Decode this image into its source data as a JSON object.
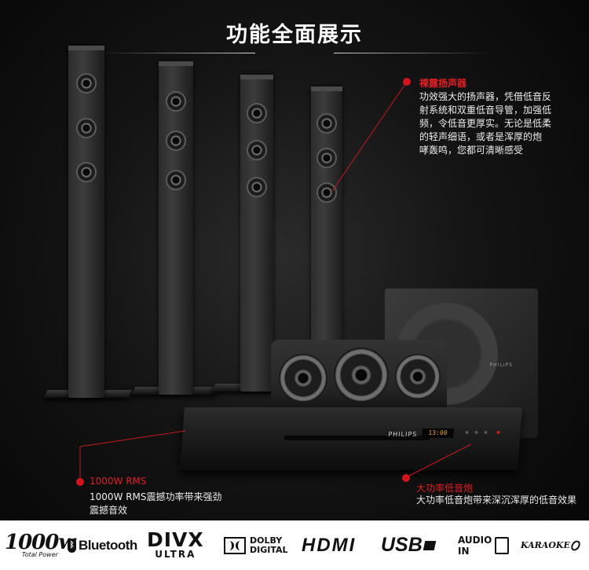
{
  "header": {
    "title": "功能全面展示"
  },
  "annotations": {
    "speakers": {
      "title": "裸露扬声器",
      "lines": [
        "功效强大的扬声器，凭借低音反",
        "射系统和双重低音导管，加强低",
        "频，令低音更厚实。无论是低柔",
        "的轻声细语，或者是浑厚的炮",
        "哮轰鸣，您都可清晰感受"
      ]
    },
    "power": {
      "title": "1000W RMS",
      "lines": [
        "1000W RMS震撼功率带来强劲",
        "震撼音效"
      ]
    },
    "subwoofer": {
      "title": "大功率低音炮",
      "lines": [
        "大功率低音炮带来深沉浑厚的低音效果"
      ]
    }
  },
  "product": {
    "subwoofer_brand": "PHILIPS",
    "player_brand": "PHILIPS",
    "display_text": "13:00"
  },
  "features": [
    {
      "icon": "power-1000w-logo",
      "label": "1000w",
      "sub": "Total Power"
    },
    {
      "icon": "bluetooth-logo",
      "label": "Bluetooth"
    },
    {
      "icon": "divx-ultra-logo",
      "label": "DIVX",
      "sub": "ULTRA"
    },
    {
      "icon": "dolby-digital-logo",
      "label": "DOLBY",
      "sub": "DIGITAL"
    },
    {
      "icon": "hdmi-logo",
      "label": "HDMI"
    },
    {
      "icon": "usb-logo",
      "label": "USB"
    },
    {
      "icon": "audio-in-logo",
      "label": "AUDIO",
      "sub": "IN"
    },
    {
      "icon": "karaoke-logo",
      "label": "KARAOKE"
    }
  ],
  "colors": {
    "accent": "#e21d26",
    "background": "#0b0b0b",
    "logo_bar": "#ffffff"
  }
}
